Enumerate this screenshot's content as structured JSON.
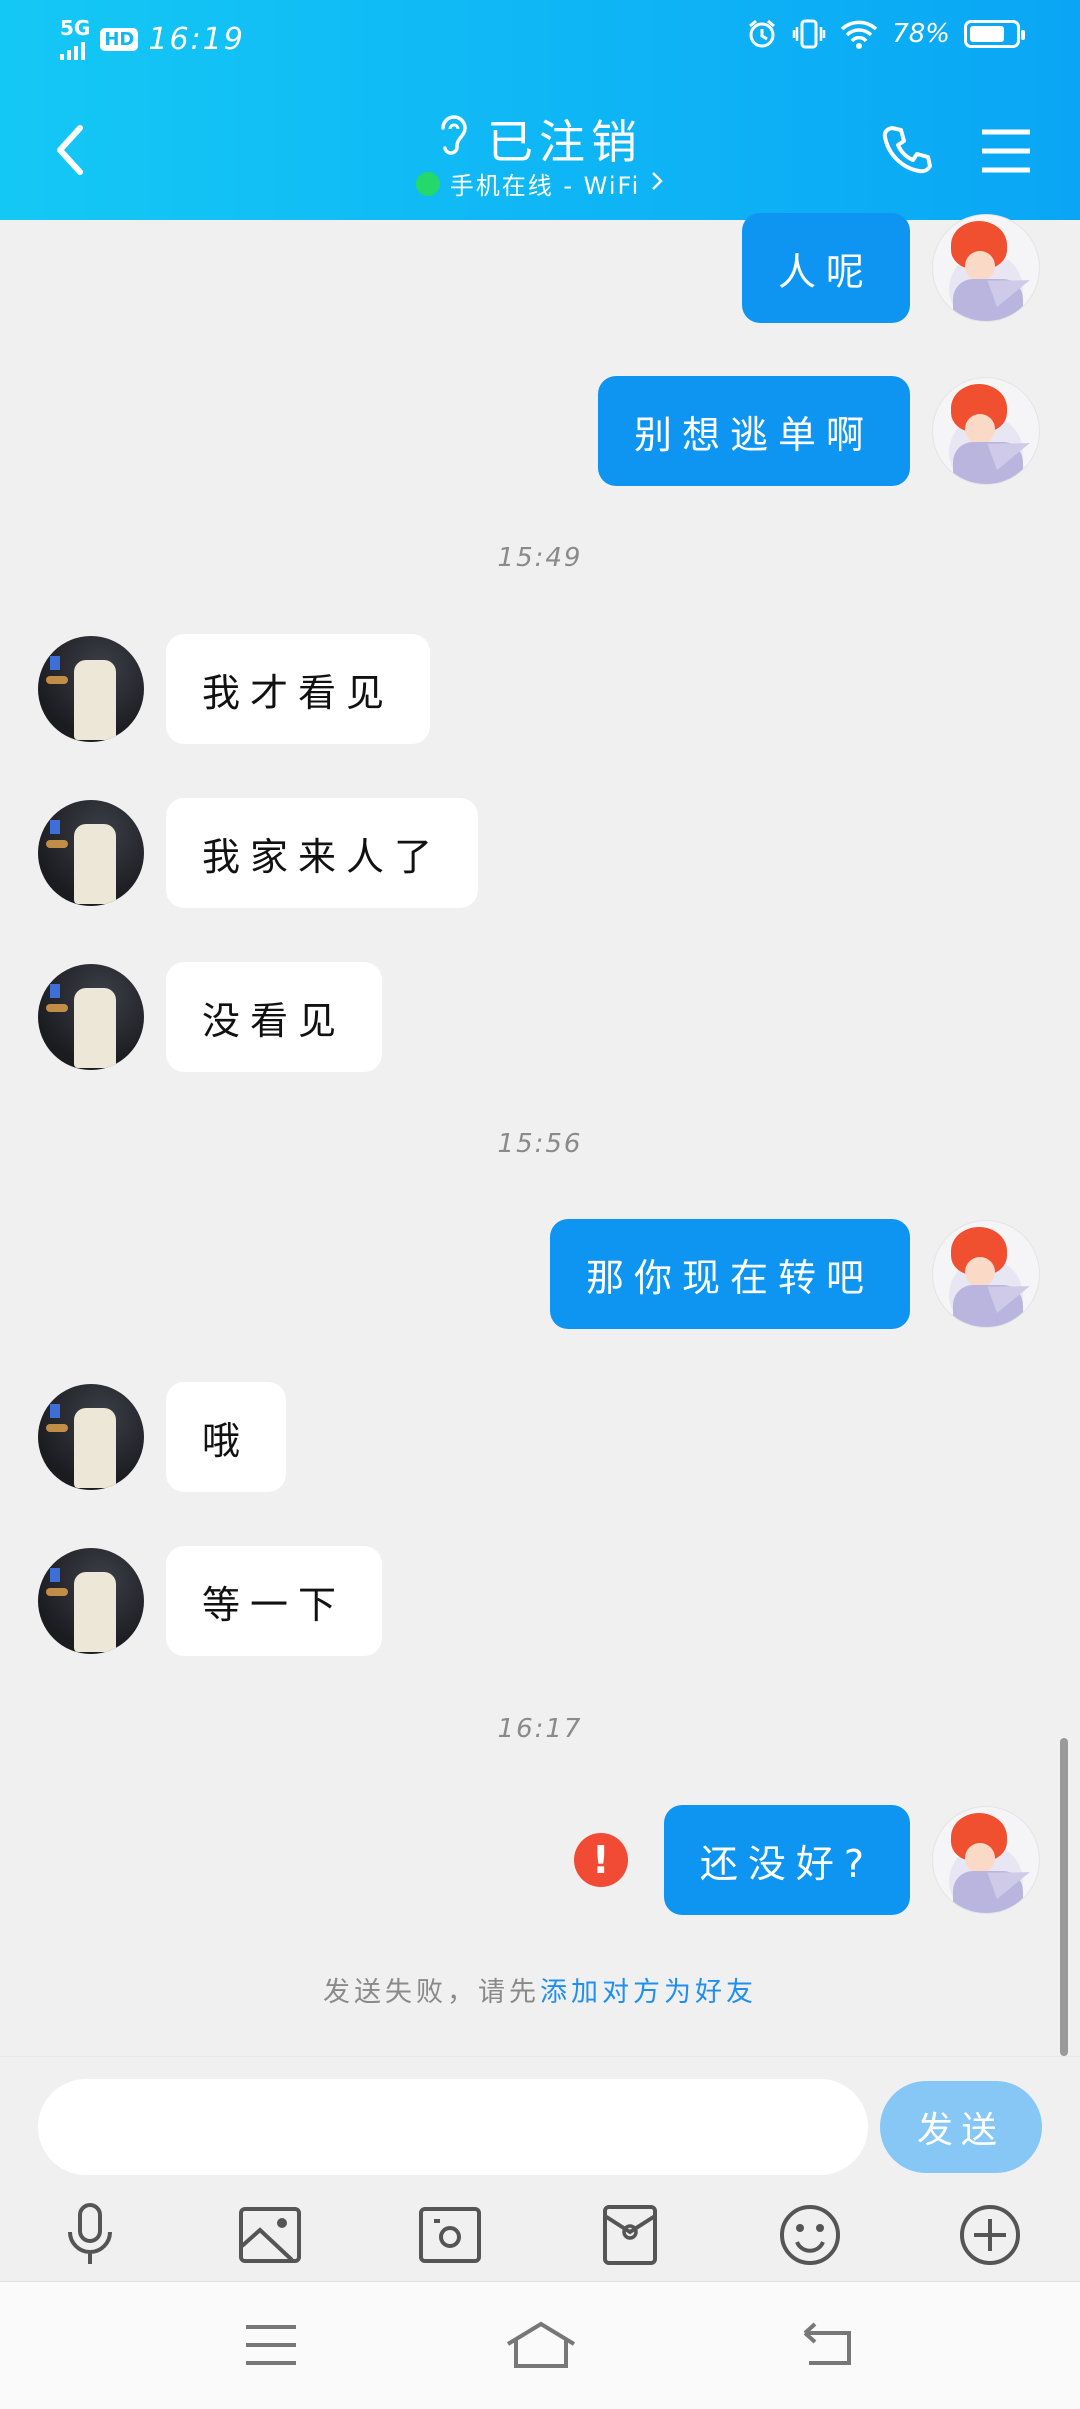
{
  "status_bar": {
    "network": "5G",
    "hd_label": "HD",
    "time": "16:19",
    "battery_text": "78%",
    "battery_level": 0.78
  },
  "header": {
    "title": "已注销",
    "subtitle": "手机在线 - WiFi",
    "background": "#0fb4f5",
    "online_color": "#23d96b"
  },
  "messages": [
    {
      "side": "self",
      "text": "人呢"
    },
    {
      "side": "self",
      "text": "别想逃单啊"
    },
    {
      "type": "time",
      "text": "15:49"
    },
    {
      "side": "peer",
      "text": "我才看见"
    },
    {
      "side": "peer",
      "text": "我家来人了"
    },
    {
      "side": "peer",
      "text": "没看见"
    },
    {
      "type": "time",
      "text": "15:56"
    },
    {
      "side": "self",
      "text": "那你现在转吧"
    },
    {
      "side": "peer",
      "text": "哦"
    },
    {
      "side": "peer",
      "text": "等一下"
    },
    {
      "type": "time",
      "text": "16:17"
    },
    {
      "side": "self",
      "text": "还没好?",
      "failed": true
    }
  ],
  "fail_notice": {
    "prefix": "发送失败，请先",
    "link": "添加对方为好友"
  },
  "composer": {
    "input_value": "",
    "input_placeholder": "",
    "send_label": "发送"
  },
  "toolbar": [
    "microphone-icon",
    "picture-icon",
    "camera-icon",
    "red-packet-icon",
    "emoji-icon",
    "plus-icon"
  ],
  "system_nav": [
    "menu-icon",
    "home-icon",
    "back-icon"
  ],
  "colors": {
    "self_bubble": "#0e95f2",
    "peer_bubble": "#ffffff",
    "chat_bg": "#f0f0f0",
    "fail_red": "#f24b35",
    "link_blue": "#1f8ff0",
    "send_button": "#86c7f6"
  }
}
